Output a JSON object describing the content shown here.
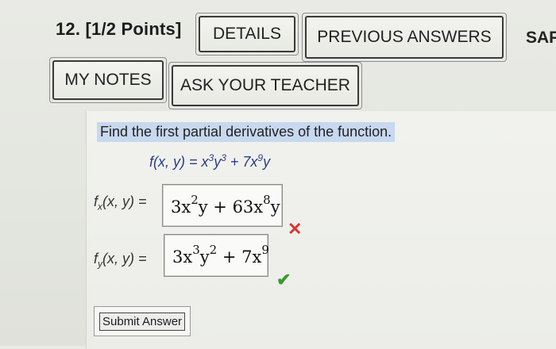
{
  "question": {
    "number": "12.",
    "points": "[1/2 Points]"
  },
  "buttons": {
    "details": "DETAILS",
    "previous_answers": "PREVIOUS ANSWERS",
    "sap": "SAP",
    "my_notes": "MY NOTES",
    "ask_teacher": "ASK YOUR TEACHER",
    "submit": "Submit Answer"
  },
  "problem": {
    "prompt": "Find the first partial derivatives of the function.",
    "function_lhs": "f(x, y) = x",
    "function_e1": "3",
    "function_mid": "y",
    "function_e2": "3",
    "function_plus": " + 7x",
    "function_e3": "9",
    "function_end": "y"
  },
  "answers": {
    "fx_label": "f",
    "fx_sub": "x",
    "fx_args": "(x, y) =",
    "fx_value": {
      "a": "3x",
      "a_exp": "2",
      "b": "y + 63x",
      "b_exp": "8",
      "c": "y"
    },
    "fx_status": "incorrect",
    "fy_label": "f",
    "fy_sub": "y",
    "fy_args": "(x, y) =",
    "fy_value": {
      "a": "3x",
      "a_exp": "3",
      "b": "y",
      "b_exp": "2",
      "c": " + 7x",
      "c_exp": "9"
    },
    "fy_status": "correct"
  },
  "icons": {
    "incorrect": "cross-icon",
    "correct": "check-icon"
  },
  "colors": {
    "highlight": "#c7d8ef",
    "incorrect": "#d9362f",
    "correct": "#3c9a2e",
    "function_text": "#2a3c8a"
  }
}
